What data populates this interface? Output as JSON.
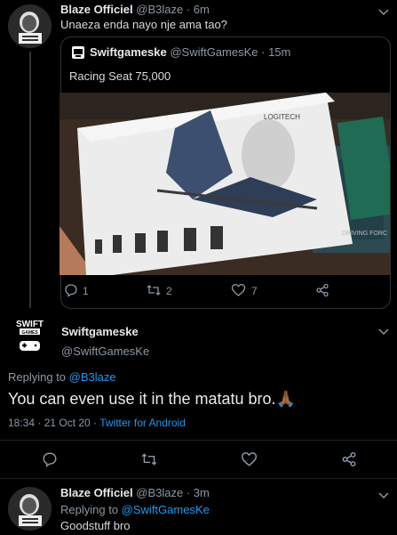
{
  "tweet1": {
    "name": "Blaze Officiel",
    "handle": "@B3laze",
    "time": "· 6m",
    "text": "Unaeza enda nayo nje ama tao?"
  },
  "quoted": {
    "name": "Swiftgameske",
    "handle": "@SwiftGamesKe",
    "time": "· 15m",
    "text": "Racing Seat 75,000",
    "box_label": "LOGITECH",
    "box_side_text": "DRIVING FORC"
  },
  "tweet1_actions": {
    "reply": "1",
    "retweet": "2",
    "like": "7"
  },
  "tweet2": {
    "name": "Swiftgameske",
    "handle": "@SwiftGamesKe",
    "avatar_text_top": "SWIFT",
    "avatar_text_bottom": "GAMES",
    "replying_prefix": "Replying to",
    "replying_to": "@B3laze",
    "text": "You can even use it in the matatu bro.",
    "emoji": "🙏🏾",
    "time": "18:34 · 21 Oct 20 ·",
    "client": "Twitter for Android"
  },
  "tweet3": {
    "name": "Blaze Officiel",
    "handle": "@B3laze",
    "time": "· 3m",
    "replying_prefix": "Replying to",
    "replying_to": "@SwiftGamesKe",
    "text": "Goodstuff bro"
  },
  "colors": {
    "accent": "#1d9bf0",
    "muted": "#8b98a5",
    "bg": "#000000"
  }
}
